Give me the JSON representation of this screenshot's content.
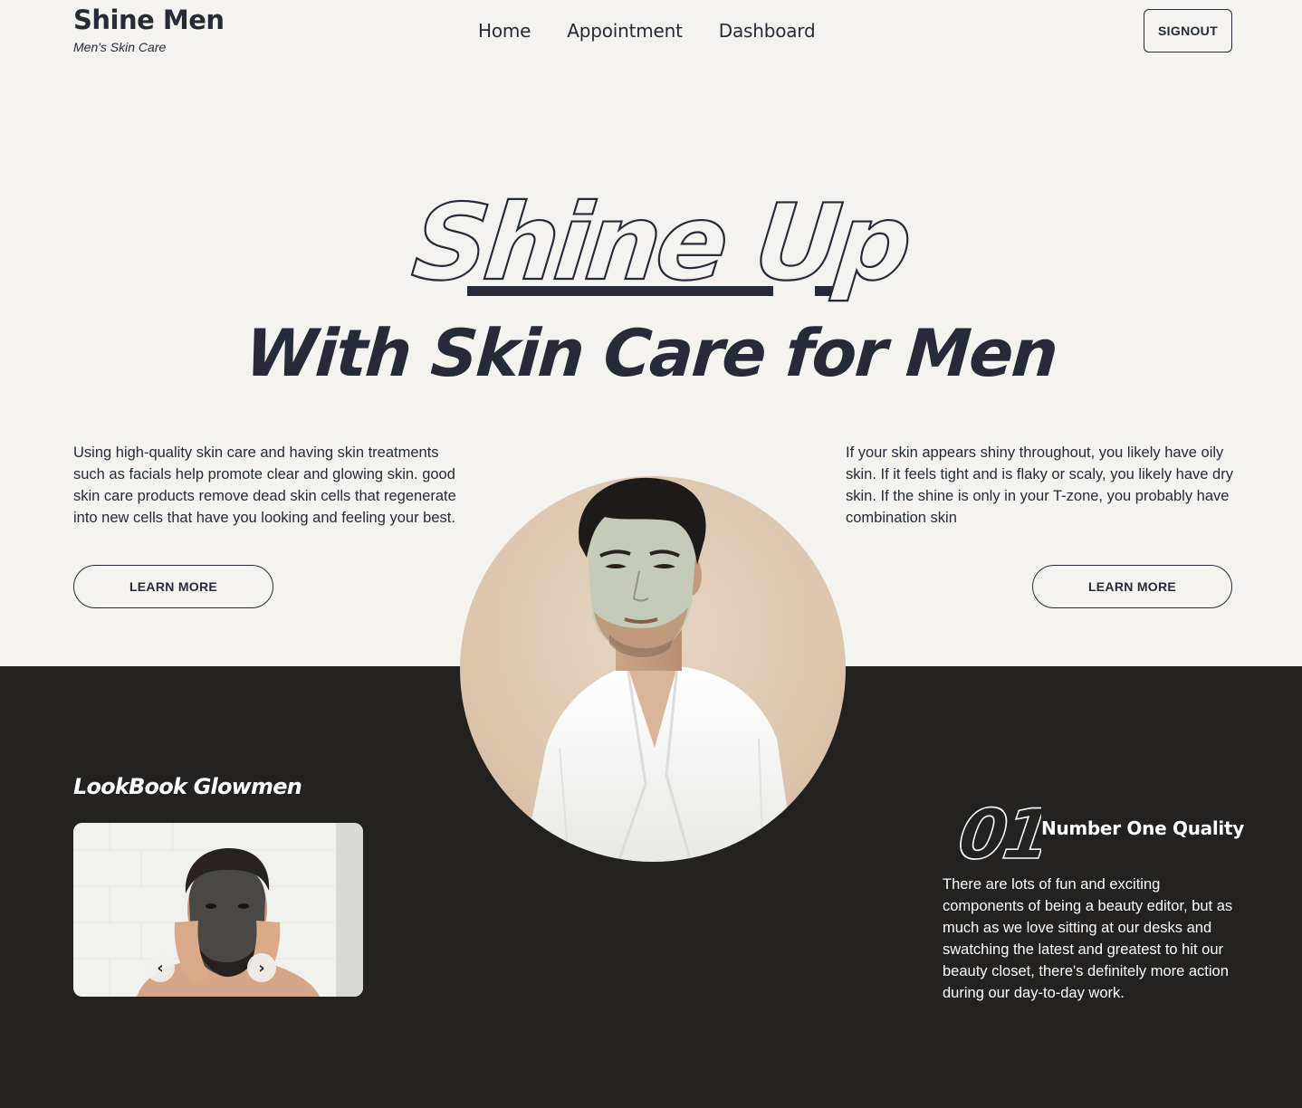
{
  "brand": {
    "name": "Shine Men",
    "tagline": "Men's Skin Care"
  },
  "nav": {
    "items": [
      {
        "label": "Home"
      },
      {
        "label": "Appointment"
      },
      {
        "label": "Dashboard"
      }
    ]
  },
  "header": {
    "signout_label": "SIGNOUT"
  },
  "hero": {
    "outline_title": "Shine Up",
    "subtitle": "With Skin Care for Men",
    "left_text": "Using high-quality skin care and having skin treatments such as facials help promote clear and glowing skin. good skin care products remove dead skin cells that regenerate into new cells that have you looking and feeling your best.",
    "right_text": "If your skin appears shiny throughout, you likely have oily skin. If it feels tight and is flaky or scaly, you likely have dry skin. If the shine is only in your T-zone, you probably have combination skin",
    "left_button": "LEARN MORE",
    "right_button": "LEARN MORE"
  },
  "lookbook": {
    "title": "LookBook Glowmen",
    "prev_icon": "‹",
    "next_icon": "›"
  },
  "quality": {
    "number": "01",
    "title": "Number One Quality",
    "text": "There are lots of fun and exciting components of being a beauty editor, but as much as we love sitting at our desks and swatching the latest and greatest to hit our beauty closet, there's definitely more action during our day-to-day work."
  },
  "colors": {
    "background": "#f4f3ef",
    "dark_section": "#232221",
    "text": "#262b38",
    "white": "#ffffff"
  }
}
